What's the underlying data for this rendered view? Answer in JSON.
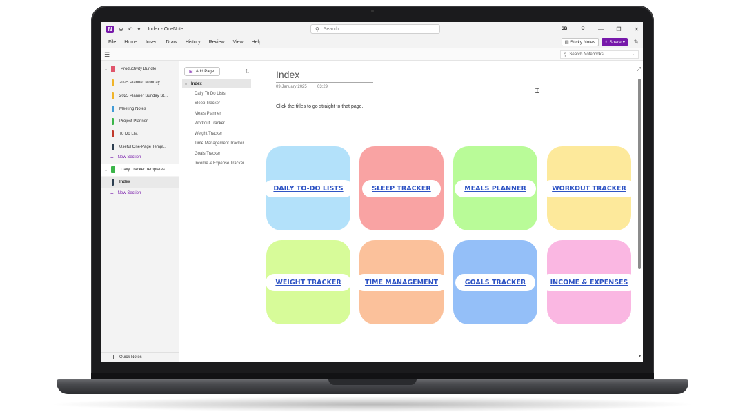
{
  "window": {
    "title": "Index - OneNote",
    "app_logo": "N",
    "search_placeholder": "Search",
    "avatar_initials": "SB"
  },
  "menu": {
    "items": [
      "File",
      "Home",
      "Insert",
      "Draw",
      "History",
      "Review",
      "View",
      "Help"
    ],
    "sticky_notes": "Sticky Notes",
    "share": "Share"
  },
  "subbar": {
    "notebook_search_placeholder": "Search Notebooks"
  },
  "notebooks": {
    "productivity_bundle": {
      "name": "Productivity Bundle",
      "color": "#e0546b",
      "sections": [
        {
          "label": "2025 Planner Monday...",
          "color": "#f0b429"
        },
        {
          "label": "2025 Planner Sunday St...",
          "color": "#f0b429"
        },
        {
          "label": "Meeting Notes",
          "color": "#3f9ad6"
        },
        {
          "label": "Project Planner",
          "color": "#3bb54a"
        },
        {
          "label": "To Do List",
          "color": "#c0392b"
        },
        {
          "label": "Useful One-Page Templ...",
          "color": "#2c3e50"
        }
      ],
      "new_section": "New Section"
    },
    "daily_tracker": {
      "name": "Daily Tracker Templates",
      "color": "#3bb54a",
      "sections": [
        {
          "label": "Index",
          "color": "#2c3e50"
        }
      ],
      "new_section": "New Section"
    },
    "quick_notes": "Quick Notes"
  },
  "pages": {
    "add_page": "Add Page",
    "items": [
      "Index",
      "Daily To Do Lists",
      "Sleep Tracker",
      "Meals Planner",
      "Workout Tracker",
      "Weight Tracker",
      "Time Management Tracker",
      "Goals Tracker",
      "Income & Expense Tracker"
    ]
  },
  "page": {
    "title": "Index",
    "date": "09 January 2025",
    "time": "03:29",
    "instruction": "Click the titles to go straight to that page.",
    "tiles": [
      {
        "label": "DAILY TO-DO LISTS",
        "color": "#b3e1fa"
      },
      {
        "label": "SLEEP TRACKER",
        "color": "#f9a3a3"
      },
      {
        "label": "MEALS PLANNER",
        "color": "#b9fb98"
      },
      {
        "label": "WORKOUT TRACKER",
        "color": "#fde99b"
      },
      {
        "label": "WEIGHT TRACKER",
        "color": "#d7fb99"
      },
      {
        "label": "TIME MANAGEMENT",
        "color": "#fbc19b"
      },
      {
        "label": "GOALS TRACKER",
        "color": "#94bff8"
      },
      {
        "label": "INCOME & EXPENSES",
        "color": "#fab7e2"
      }
    ]
  }
}
